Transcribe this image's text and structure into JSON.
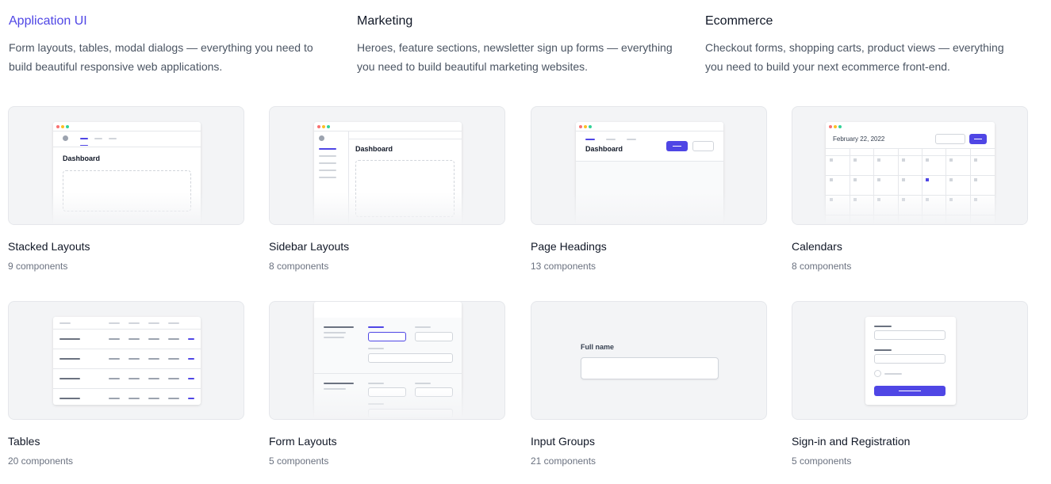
{
  "categories": [
    {
      "title": "Application UI",
      "description": "Form layouts, tables, modal dialogs — everything you need to build beautiful responsive web applications.",
      "active": true
    },
    {
      "title": "Marketing",
      "description": "Heroes, feature sections, newsletter sign up forms — everything you need to build beautiful marketing websites.",
      "active": false
    },
    {
      "title": "Ecommerce",
      "description": "Checkout forms, shopping carts, product views — everything you need to build your next ecommerce front-end.",
      "active": false
    }
  ],
  "cards": [
    {
      "title": "Stacked Layouts",
      "count": "9 components",
      "preview_text": "Dashboard"
    },
    {
      "title": "Sidebar Layouts",
      "count": "8 components",
      "preview_text": "Dashboard"
    },
    {
      "title": "Page Headings",
      "count": "13 components",
      "preview_text": "Dashboard"
    },
    {
      "title": "Calendars",
      "count": "8 components",
      "preview_text": "February 22, 2022"
    },
    {
      "title": "Tables",
      "count": "20 components"
    },
    {
      "title": "Form Layouts",
      "count": "5 components"
    },
    {
      "title": "Input Groups",
      "count": "21 components",
      "preview_text": "Full name"
    },
    {
      "title": "Sign-in and Registration",
      "count": "5 components"
    }
  ],
  "colors": {
    "accent": "#4f46e5",
    "card_bg": "#f3f4f6",
    "muted_text": "#6b7280"
  }
}
